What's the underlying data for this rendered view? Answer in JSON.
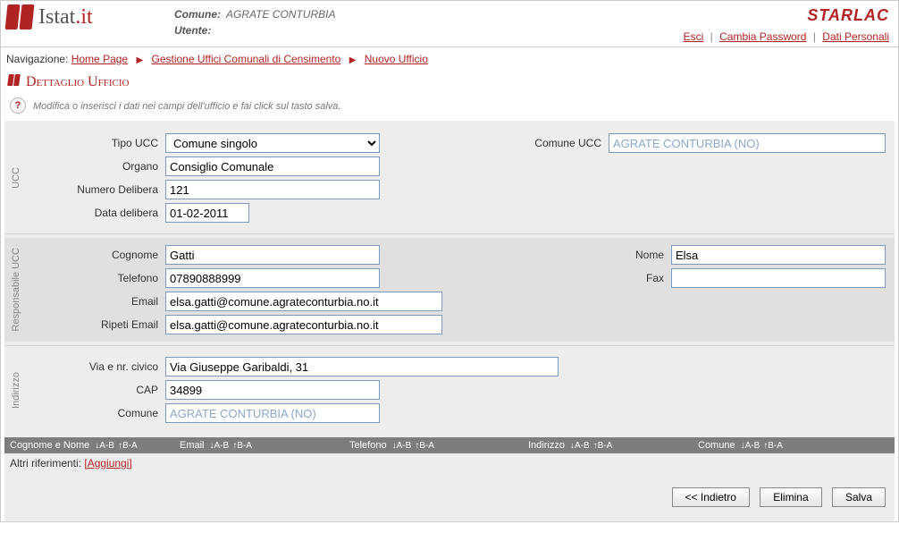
{
  "header": {
    "comune_label": "Comune:",
    "comune_value": "AGRATE CONTURBIA",
    "utente_label": "Utente:",
    "utente_value": "",
    "brand": "STARLAC",
    "logo_text_main": "Istat",
    "logo_text_dot": ".it",
    "links": {
      "esci": "Esci",
      "cambia_password": "Cambia Password",
      "dati_personali": "Dati Personali"
    }
  },
  "breadcrumb": {
    "label": "Navigazione:",
    "home": "Home Page",
    "level1": "Gestione Uffici Comunali di Censimento",
    "level2": "Nuovo Ufficio"
  },
  "section_title": "Dettaglio Ufficio",
  "helptext": "Modifica o inserisci i dati nei campi dell'ufficio e fai click sul tasto salva.",
  "sections": {
    "ucc": {
      "side": "UCC",
      "tipo_ucc_label": "Tipo UCC",
      "tipo_ucc_value": "Comune singolo",
      "comune_ucc_label": "Comune UCC",
      "comune_ucc_value": "AGRATE CONTURBIA (NO)",
      "organo_label": "Organo",
      "organo_value": "Consiglio Comunale",
      "numero_delibera_label": "Numero Delibera",
      "numero_delibera_value": "121",
      "data_delibera_label": "Data delibera",
      "data_delibera_value": "01-02-2011"
    },
    "resp": {
      "side": "Responsabile UCC",
      "cognome_label": "Cognome",
      "cognome_value": "Gatti",
      "nome_label": "Nome",
      "nome_value": "Elsa",
      "telefono_label": "Telefono",
      "telefono_value": "07890888999",
      "fax_label": "Fax",
      "fax_value": "",
      "email_label": "Email",
      "email_value": "elsa.gatti@comune.agrateconturbia.no.it",
      "ripeti_email_label": "Ripeti Email",
      "ripeti_email_value": "elsa.gatti@comune.agrateconturbia.no.it"
    },
    "indirizzo": {
      "side": "Indirizzo",
      "via_label": "Via e nr. civico",
      "via_value": "Via Giuseppe Garibaldi, 31",
      "cap_label": "CAP",
      "cap_value": "34899",
      "comune_label": "Comune",
      "comune_value": "AGRATE CONTURBIA (NO)"
    }
  },
  "table": {
    "columns": {
      "cognome_nome": "Cognome e Nome",
      "email": "Email",
      "telefono": "Telefono",
      "indirizzo": "Indirizzo",
      "comune": "Comune"
    },
    "sort_asc": "↓A-B",
    "sort_desc": "↑B-A"
  },
  "refline": {
    "label": "Altri riferimenti:",
    "link": "[Aggiungi]"
  },
  "buttons": {
    "indietro": "<< Indietro",
    "elimina": "Elimina",
    "salva": "Salva"
  }
}
